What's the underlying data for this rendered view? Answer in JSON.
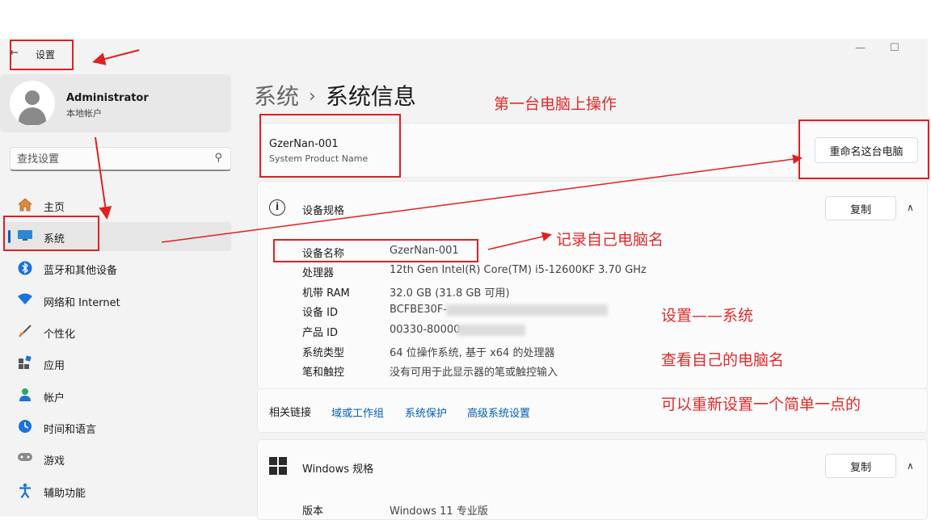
{
  "window": {
    "title": "设置",
    "back_glyph": "←",
    "minimize_glyph": "—",
    "maximize_glyph": "☐"
  },
  "user": {
    "name": "Administrator",
    "account_type": "本地帐户"
  },
  "search": {
    "placeholder": "查找设置",
    "icon": "search-icon"
  },
  "sidebar": {
    "items": [
      {
        "label": "主页",
        "icon": "home-icon",
        "active": false
      },
      {
        "label": "系统",
        "icon": "monitor-icon",
        "active": true
      },
      {
        "label": "蓝牙和其他设备",
        "icon": "bluetooth-icon",
        "active": false
      },
      {
        "label": "网络和 Internet",
        "icon": "wifi-icon",
        "active": false
      },
      {
        "label": "个性化",
        "icon": "brush-icon",
        "active": false
      },
      {
        "label": "应用",
        "icon": "apps-icon",
        "active": false
      },
      {
        "label": "帐户",
        "icon": "account-icon",
        "active": false
      },
      {
        "label": "时间和语言",
        "icon": "globe-clock-icon",
        "active": false
      },
      {
        "label": "游戏",
        "icon": "gamepad-icon",
        "active": false
      },
      {
        "label": "辅助功能",
        "icon": "accessibility-icon",
        "active": false
      }
    ]
  },
  "breadcrumb": {
    "parent": "系统",
    "separator": "›",
    "current": "系统信息"
  },
  "pc": {
    "name": "GzerNan-001",
    "model": "System Product Name",
    "rename_label": "重命名这台电脑"
  },
  "device_specs": {
    "title": "设备规格",
    "copy_label": "复制",
    "collapse_glyph": "∧",
    "rows": [
      {
        "label": "设备名称",
        "value": "GzerNan-001"
      },
      {
        "label": "处理器",
        "value": "12th Gen Intel(R) Core(TM) i5-12600KF   3.70 GHz"
      },
      {
        "label": "机带 RAM",
        "value": "32.0 GB (31.8 GB 可用)"
      },
      {
        "label": "设备 ID",
        "value": "BCFBE30F-"
      },
      {
        "label": "产品 ID",
        "value": "00330-80000"
      },
      {
        "label": "系统类型",
        "value": "64 位操作系统, 基于 x64 的处理器"
      },
      {
        "label": "笔和触控",
        "value": "没有可用于此显示器的笔或触控输入"
      }
    ]
  },
  "related_links": {
    "title": "相关链接",
    "links": [
      "域或工作组",
      "系统保护",
      "高级系统设置"
    ]
  },
  "windows_specs": {
    "title": "Windows 规格",
    "copy_label": "复制",
    "collapse_glyph": "∧",
    "rows": [
      {
        "label": "版本",
        "value": "Windows 11 专业版"
      }
    ]
  },
  "annotations": {
    "note1": "第一台电脑上操作",
    "note2": "记录自己电脑名",
    "note3": "设置——系统",
    "note4": "查看自己的电脑名",
    "note5": "可以重新设置一个简单一点的",
    "color": "#e02020"
  },
  "colors": {
    "accent": "#005fb8",
    "window_bg": "#f3f3f3",
    "card_bg": "#fbfbfb"
  }
}
